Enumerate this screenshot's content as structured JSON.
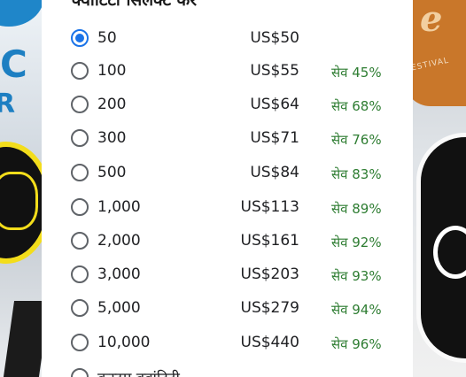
{
  "dialog": {
    "title": "क्वांटिटी सिलेक्ट करें",
    "selected_index": 0,
    "options": [
      {
        "quantity": "50",
        "price": "US$50",
        "savings": ""
      },
      {
        "quantity": "100",
        "price": "US$55",
        "savings": "सेव 45%"
      },
      {
        "quantity": "200",
        "price": "US$64",
        "savings": "सेव 68%"
      },
      {
        "quantity": "300",
        "price": "US$71",
        "savings": "सेव 76%"
      },
      {
        "quantity": "500",
        "price": "US$84",
        "savings": "सेव 83%"
      },
      {
        "quantity": "1,000",
        "price": "US$113",
        "savings": "सेव 89%"
      },
      {
        "quantity": "2,000",
        "price": "US$161",
        "savings": "सेव 92%"
      },
      {
        "quantity": "3,000",
        "price": "US$203",
        "savings": "सेव 93%"
      },
      {
        "quantity": "5,000",
        "price": "US$279",
        "savings": "सेव 94%"
      },
      {
        "quantity": "10,000",
        "price": "US$440",
        "savings": "सेव 96%"
      }
    ],
    "custom_option_label": "कस्टम क्वांटिटी"
  },
  "colors": {
    "accent": "#1a73e8",
    "savings_text": "#2e7d32"
  }
}
